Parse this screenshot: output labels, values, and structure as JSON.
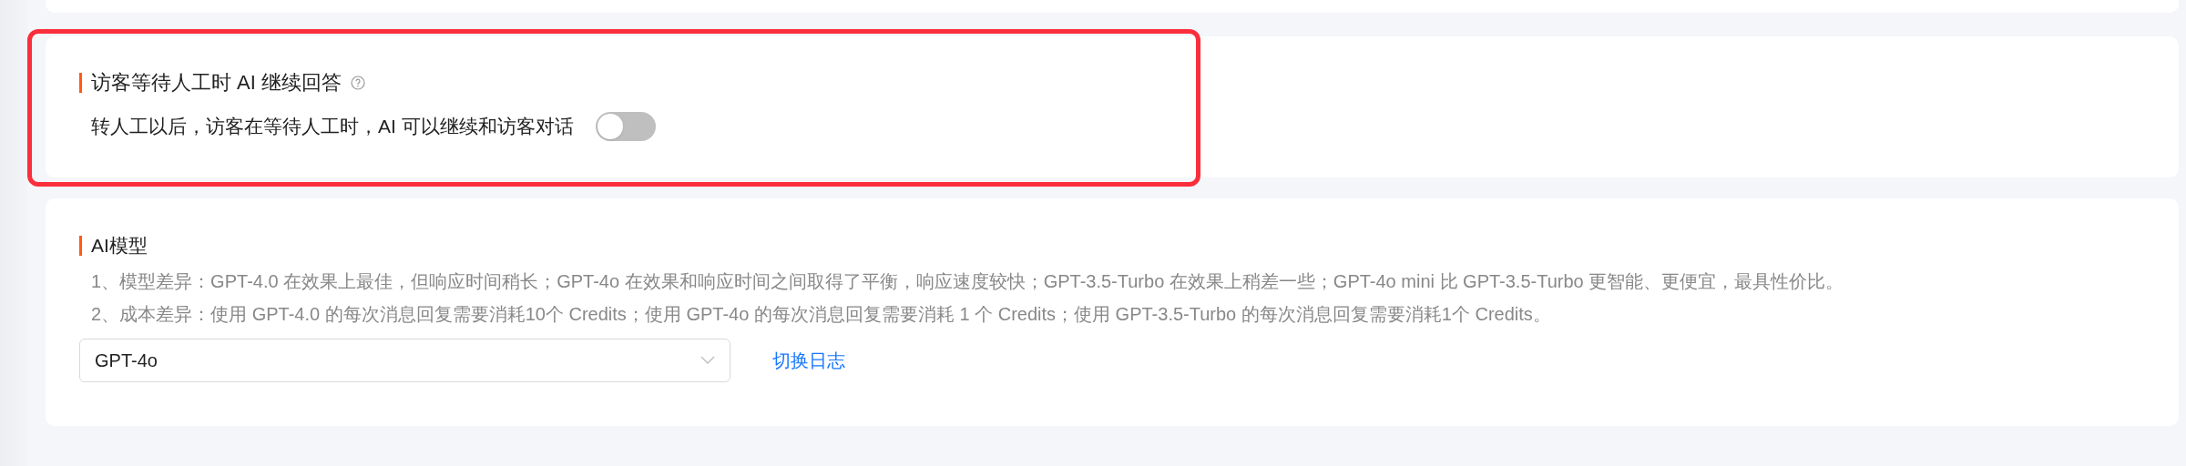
{
  "wait_setting": {
    "title": "访客等待人工时 AI 继续回答",
    "description": "转人工以后，访客在等待人工时，AI 可以继续和访客对话",
    "toggle": {
      "on": false
    },
    "highlighted": true
  },
  "ai_model": {
    "title": "AI模型",
    "notes": [
      "1、模型差异：GPT-4.0 在效果上最佳，但响应时间稍长；GPT-4o 在效果和响应时间之间取得了平衡，响应速度较快；GPT-3.5-Turbo 在效果上稍差一些；GPT-4o mini 比 GPT-3.5-Turbo 更智能、更便宜，最具性价比。",
      "2、成本差异：使用 GPT-4.0 的每次消息回复需要消耗10个 Credits；使用 GPT-4o 的每次消息回复需要消耗 1 个 Credits；使用 GPT-3.5-Turbo 的每次消息回复需要消耗1个 Credits。"
    ],
    "select": {
      "value": "GPT-4o"
    },
    "link": "切换日志"
  }
}
